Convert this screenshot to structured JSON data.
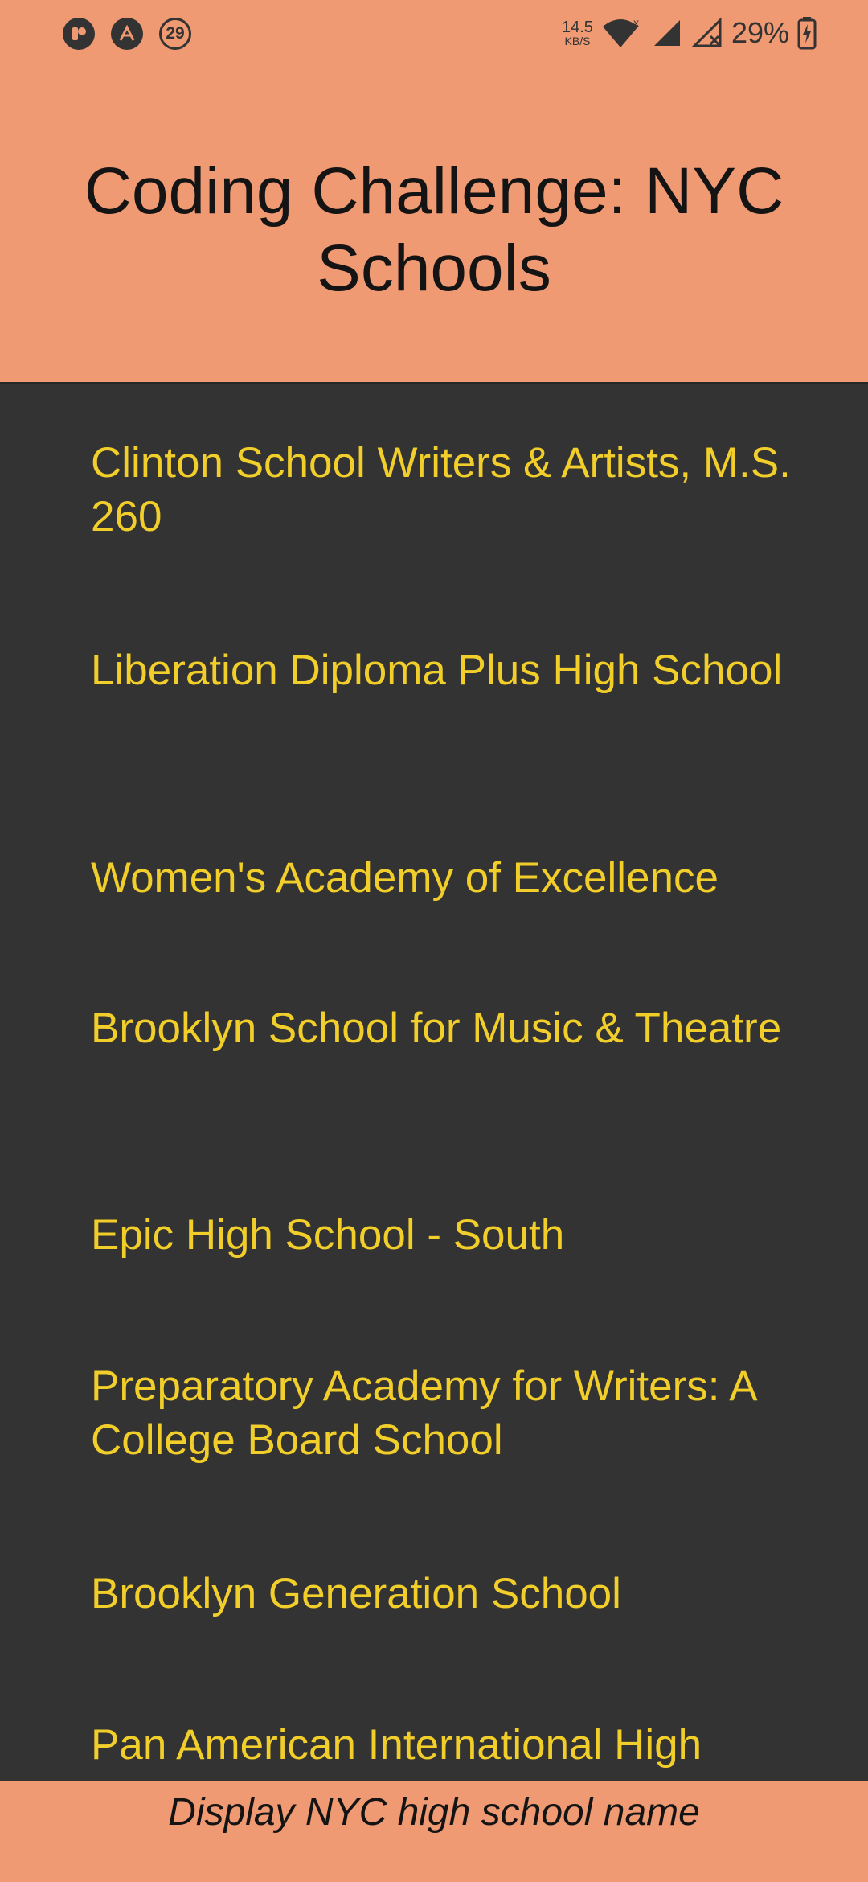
{
  "status_bar": {
    "notification_badge": "29",
    "net_speed_value": "14.5",
    "net_speed_unit": "KB/S",
    "battery_percent": "29%",
    "icons": [
      "app-notification-icon",
      "arc-app-icon",
      "number-badge-icon",
      "wifi-icon",
      "signal-icon",
      "no-signal-icon",
      "battery-charging-icon"
    ]
  },
  "header": {
    "title": "Coding Challenge: NYC Schools",
    "background": "#EF9A73"
  },
  "schools": [
    "Clinton School Writers & Artists, M.S. 260",
    "Liberation Diploma Plus High School",
    "Women's Academy of Excellence",
    "Brooklyn School for Music & Theatre",
    "Epic High School - South",
    "Preparatory Academy for Writers: A College Board School",
    "Brooklyn Generation School",
    "Pan American International High School"
  ],
  "footer": {
    "caption": "Display NYC high school name"
  },
  "colors": {
    "list_background": "#333333",
    "list_text": "#F2CE2A",
    "accent": "#EF9A73"
  }
}
